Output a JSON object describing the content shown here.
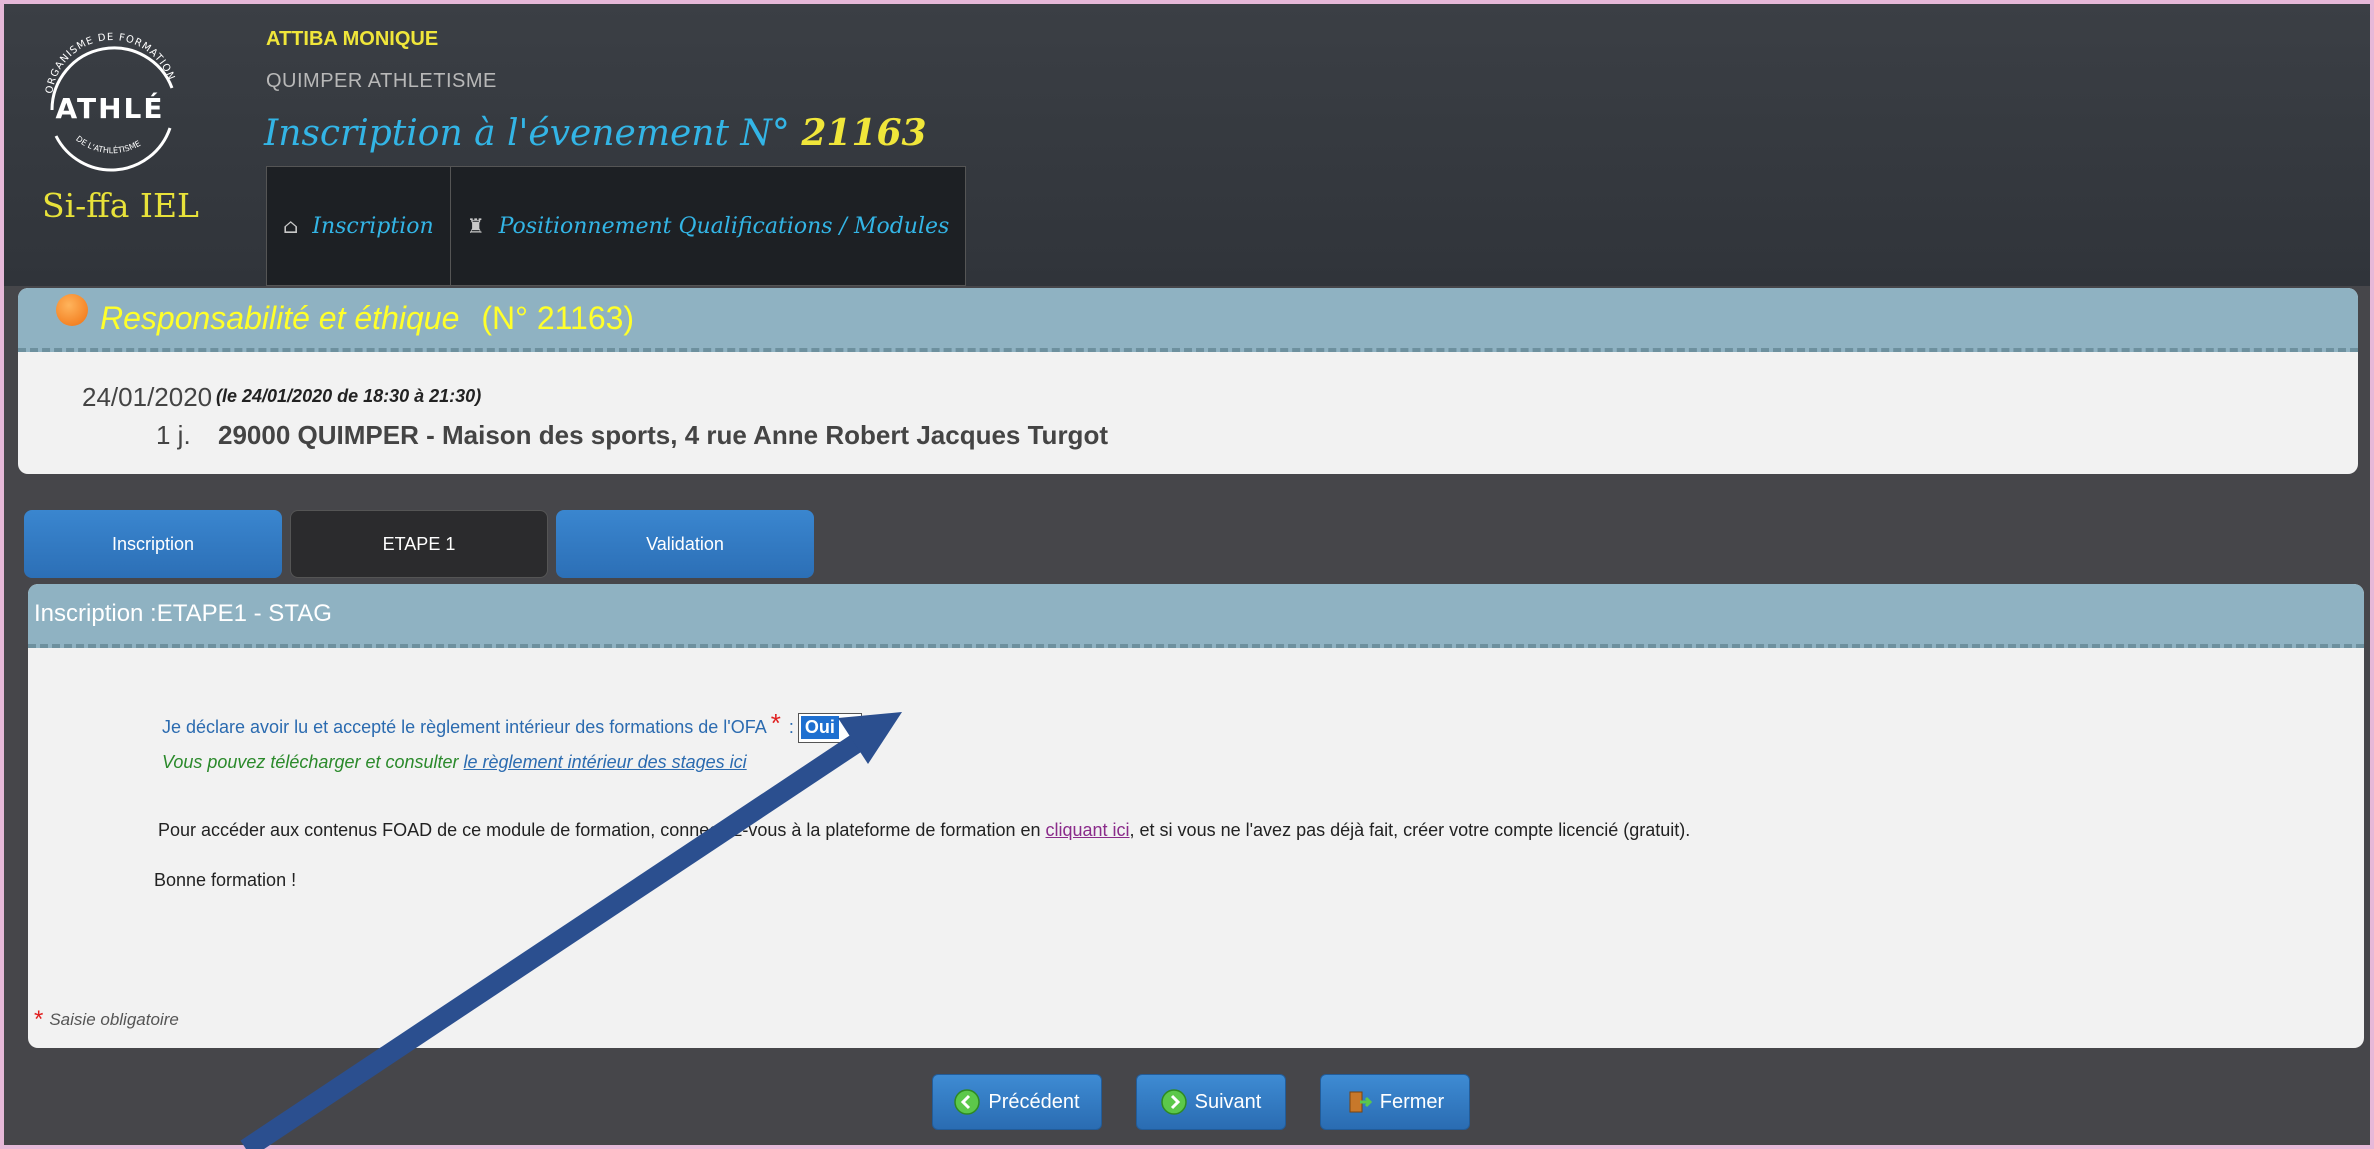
{
  "header": {
    "logo_ring_top": "ORGANISME DE FORMATION",
    "logo_wordmark": "ATHLÉ",
    "logo_ring_bottom": "DE L'ATHLÉTISME",
    "logo_caption": "Si-ffa IEL",
    "user_name": "ATTIBA MONIQUE",
    "club_name": "QUIMPER ATHLETISME",
    "event_title_prefix": "Inscription à l'évenement N°",
    "event_number": "21163",
    "nav": [
      {
        "icon": "home-icon",
        "label": "Inscription"
      },
      {
        "icon": "trophy-icon",
        "label": "Positionnement Qualifications / Modules"
      }
    ]
  },
  "event_panel": {
    "title": "Responsabilité et éthique",
    "number": "(N° 21163)",
    "date": "24/01/2020",
    "time_detail": "(le 24/01/2020 de 18:30 à 21:30)",
    "duration": "1 j.",
    "place": "29000 QUIMPER - Maison des sports, 4 rue Anne Robert Jacques Turgot"
  },
  "steps": [
    "Inscription",
    "ETAPE 1",
    "Validation"
  ],
  "form": {
    "title": "Inscription :ETAPE1 - STAG",
    "declaration": "Je déclare avoir lu et accepté le règlement intérieur des formations de l'OFA",
    "required_mark": "*",
    "colon": ":",
    "select_value": "Oui",
    "download_text": "Vous pouvez télécharger et consulter",
    "download_link": "le règlement intérieur des stages ici",
    "access_before": "Pour accéder aux contenus FOAD de ce module de formation, connectez-vous à la plateforme de formation en",
    "access_link": "cliquant ici",
    "access_after": ", et si vous ne l'avez pas déjà fait, créer votre compte licencié (gratuit).",
    "closing": "Bonne formation !",
    "mandatory_note": "Saisie obligatoire"
  },
  "buttons": {
    "previous": "Précédent",
    "next": "Suivant",
    "close": "Fermer"
  },
  "colors": {
    "accent_yellow": "#f0e63a",
    "accent_blue": "#33b5e6",
    "arrow": "#2b4f8f"
  }
}
